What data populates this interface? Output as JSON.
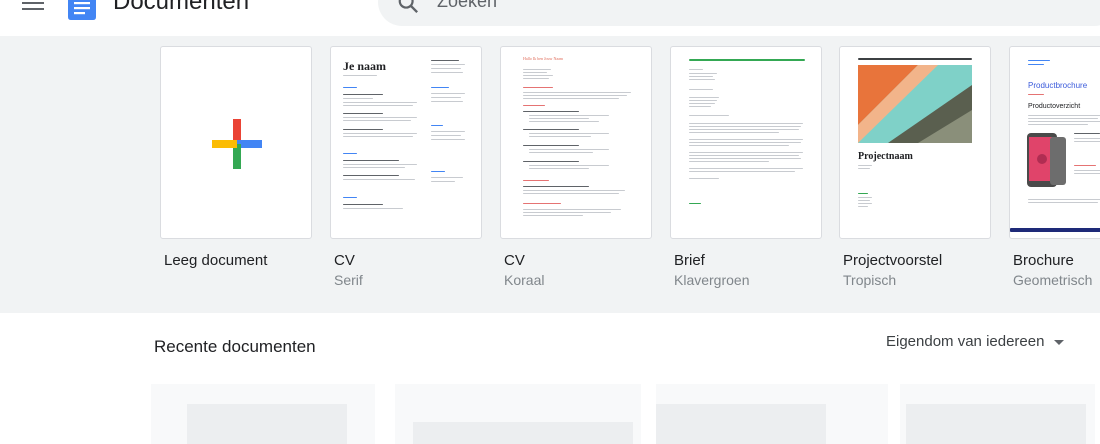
{
  "app": {
    "title": "Documenten"
  },
  "search": {
    "placeholder": "Zoeken"
  },
  "templates": [
    {
      "name": "Leeg document",
      "sub": ""
    },
    {
      "name": "CV",
      "sub": "Serif",
      "preview_heading": "Je naam"
    },
    {
      "name": "CV",
      "sub": "Koraal",
      "preview_heading": "Hallo Ik ben Jouw Naam"
    },
    {
      "name": "Brief",
      "sub": "Klavergroen"
    },
    {
      "name": "Projectvoorstel",
      "sub": "Tropisch",
      "preview_heading": "Projectnaam"
    },
    {
      "name": "Brochure",
      "sub": "Geometrisch",
      "preview_heading": "Productbrochure",
      "preview_subheading": "Productoverzicht"
    }
  ],
  "recent": {
    "title": "Recente documenten",
    "owner_filter": "Eigendom van iedereen"
  },
  "icons": {
    "menu": "menu-icon",
    "logo": "docs-logo-icon",
    "search": "search-icon",
    "blank": "plus-icon",
    "dropdown": "caret-down-icon"
  },
  "colors": {
    "docs_blue": "#4285f4",
    "plus_red": "#ea4335",
    "plus_yellow": "#fbbc04",
    "plus_green": "#34a853",
    "plus_blue": "#4285f4",
    "tropisch_teal": "#7fd1c8",
    "tropisch_orange": "#e8743b"
  }
}
